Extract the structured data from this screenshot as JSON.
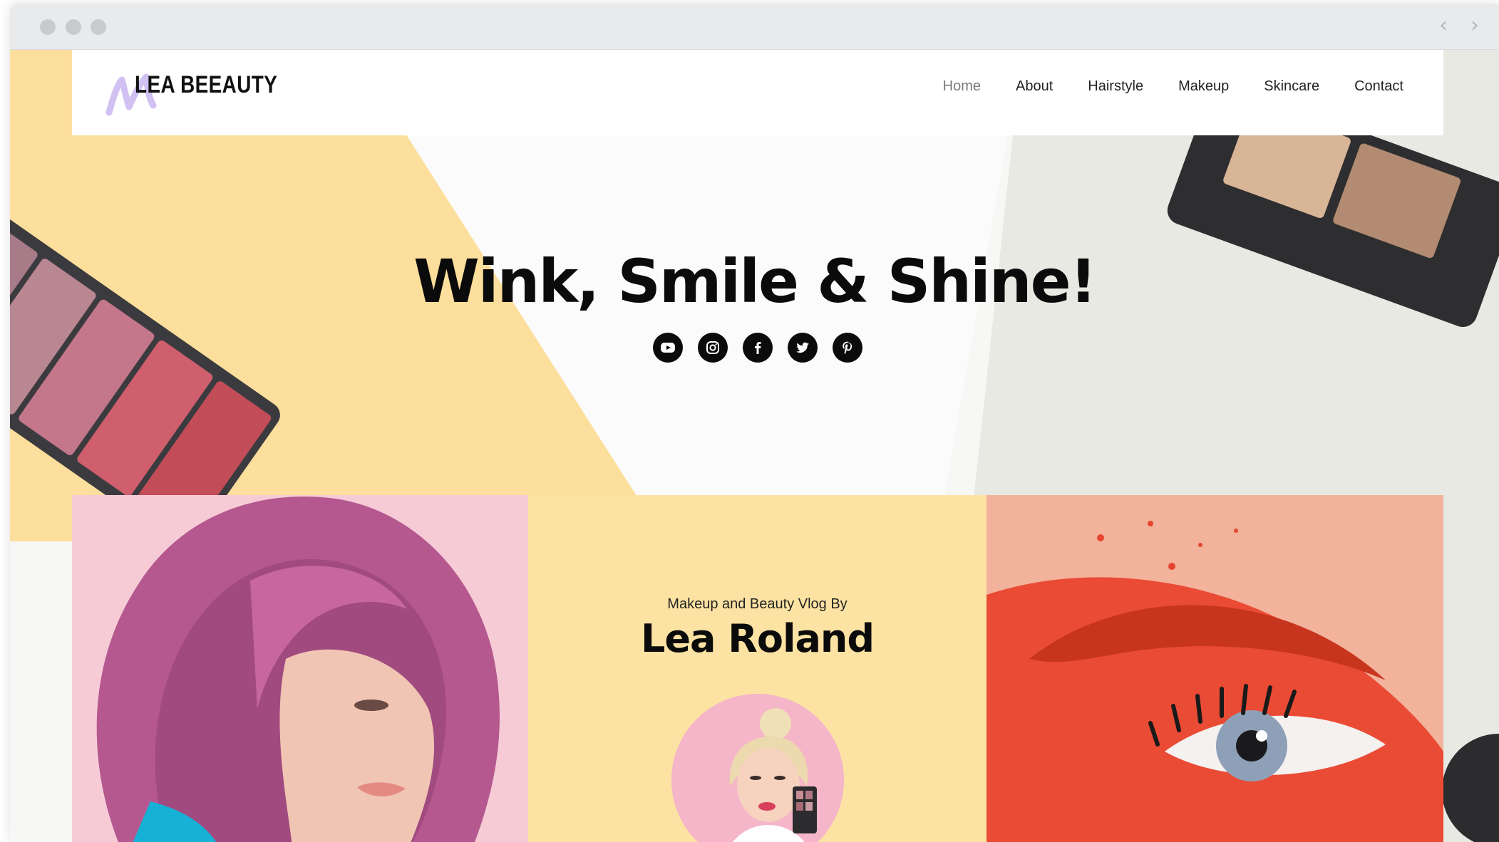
{
  "brand": {
    "name": "LEA BEEAUTY"
  },
  "nav": {
    "items": [
      "Home",
      "About",
      "Hairstyle",
      "Makeup",
      "Skincare",
      "Contact"
    ],
    "active": "Home"
  },
  "hero": {
    "title": "Wink, Smile & Shine!",
    "socials": [
      "youtube-icon",
      "instagram-icon",
      "facebook-icon",
      "twitter-icon",
      "pinterest-icon"
    ]
  },
  "intro": {
    "subtitle": "Makeup and Beauty Vlog By",
    "name": "Lea Roland"
  },
  "colors": {
    "yellow": "#fde3a3",
    "pink": "#f6c9d4",
    "text": "#0b0b0b"
  }
}
